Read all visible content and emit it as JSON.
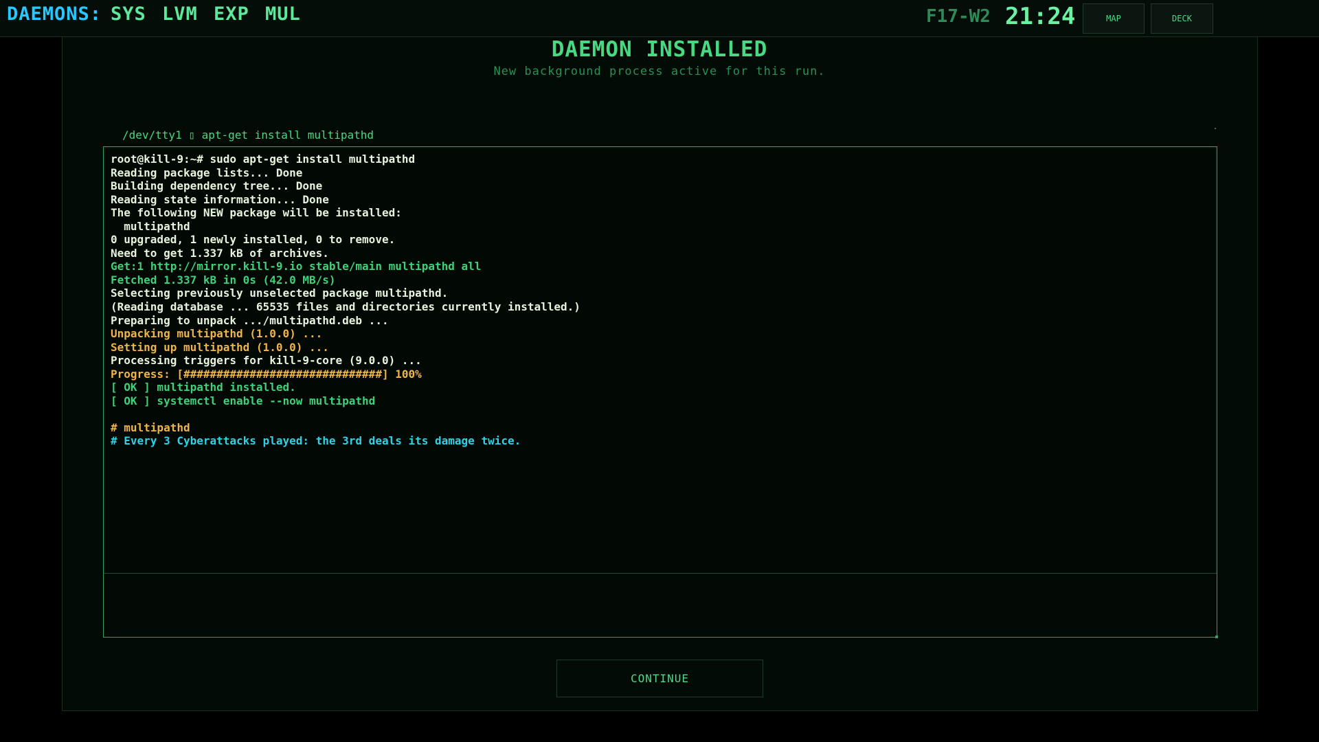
{
  "header": {
    "daemons_label": "DAEMONS:",
    "daemon_tags": [
      "SYS",
      "LVM",
      "EXP",
      "MUL"
    ],
    "floor": "F17-W2",
    "clock": "21:24",
    "map_button": "MAP",
    "deck_button": "DECK"
  },
  "main": {
    "title": "DAEMON INSTALLED",
    "subtitle": "New background process active for this run.",
    "tty_label": "/dev/tty1 ▯ apt-get install multipathd",
    "continue_label": "CONTINUE"
  },
  "terminal": {
    "lines": [
      {
        "text": "root@kill-9:~# sudo apt-get install multipathd",
        "color": "white"
      },
      {
        "text": "Reading package lists... Done",
        "color": "white"
      },
      {
        "text": "Building dependency tree... Done",
        "color": "white"
      },
      {
        "text": "Reading state information... Done",
        "color": "white"
      },
      {
        "text": "The following NEW package will be installed:",
        "color": "white"
      },
      {
        "text": "  multipathd",
        "color": "white"
      },
      {
        "text": "0 upgraded, 1 newly installed, 0 to remove.",
        "color": "white"
      },
      {
        "text": "Need to get 1.337 kB of archives.",
        "color": "white"
      },
      {
        "text": "Get:1 http://mirror.kill-9.io stable/main multipathd all",
        "color": "green"
      },
      {
        "text": "Fetched 1.337 kB in 0s (42.0 MB/s)",
        "color": "green"
      },
      {
        "text": "Selecting previously unselected package multipathd.",
        "color": "white"
      },
      {
        "text": "(Reading database ... 65535 files and directories currently installed.)",
        "color": "white"
      },
      {
        "text": "Preparing to unpack .../multipathd.deb ...",
        "color": "white"
      },
      {
        "text": "Unpacking multipathd (1.0.0) ...",
        "color": "orange"
      },
      {
        "text": "Setting up multipathd (1.0.0) ...",
        "color": "orange"
      },
      {
        "text": "Processing triggers for kill-9-core (9.0.0) ...",
        "color": "white"
      },
      {
        "text": "Progress: [##############################] 100%",
        "color": "orange"
      },
      {
        "text": "[ OK ] multipathd installed.",
        "color": "green"
      },
      {
        "text": "[ OK ] systemctl enable --now multipathd",
        "color": "green"
      },
      {
        "text": "",
        "color": "white"
      },
      {
        "text": "# multipathd",
        "color": "orange"
      },
      {
        "text": "# Every 3 Cyberattacks played: the 3rd deals its damage twice.",
        "color": "cyan"
      }
    ]
  },
  "colors": {
    "white": "#e6f3dd",
    "green": "#3fd07a",
    "orange": "#f0b548",
    "cyan": "#2ed2e8"
  }
}
